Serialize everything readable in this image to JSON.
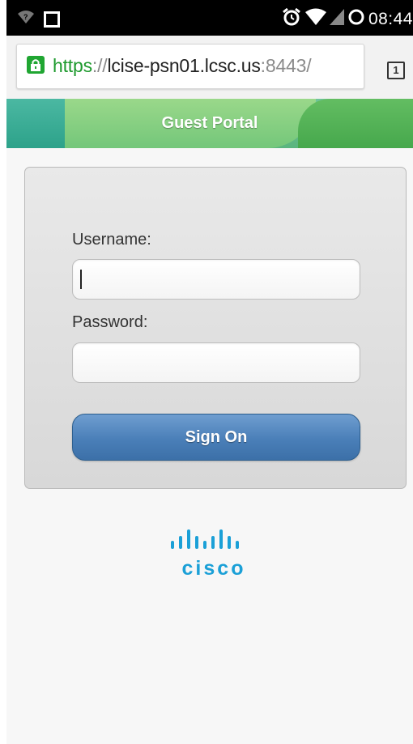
{
  "status_bar": {
    "time": "08:44",
    "icons": [
      "wifi-question-icon",
      "square-notification-icon",
      "alarm-icon",
      "wifi-signal-icon",
      "cell-signal-icon",
      "battery-icon"
    ]
  },
  "browser": {
    "url_scheme": "https",
    "url_separator": "://",
    "url_host": "lcise-psn01.lcsc.us",
    "url_port": ":8443/",
    "tab_count": "1",
    "lock_color": "#20a632"
  },
  "header": {
    "title": "Guest Portal"
  },
  "login": {
    "username_label": "Username:",
    "username_value": "",
    "password_label": "Password:",
    "password_value": "",
    "submit_label": "Sign On",
    "button_color": "#4a7fb8"
  },
  "footer": {
    "logo_text": "cisco",
    "logo_color": "#1ba0d7"
  }
}
